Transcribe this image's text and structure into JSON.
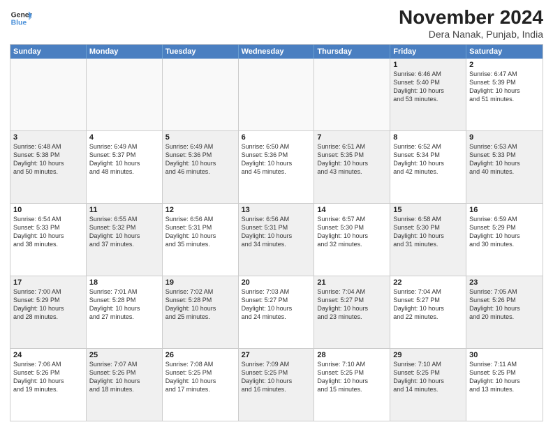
{
  "header": {
    "logo_line1": "General",
    "logo_line2": "Blue",
    "title": "November 2024",
    "subtitle": "Dera Nanak, Punjab, India"
  },
  "calendar": {
    "days": [
      "Sunday",
      "Monday",
      "Tuesday",
      "Wednesday",
      "Thursday",
      "Friday",
      "Saturday"
    ],
    "weeks": [
      [
        {
          "day": "",
          "text": "",
          "empty": true
        },
        {
          "day": "",
          "text": "",
          "empty": true
        },
        {
          "day": "",
          "text": "",
          "empty": true
        },
        {
          "day": "",
          "text": "",
          "empty": true
        },
        {
          "day": "",
          "text": "",
          "empty": true
        },
        {
          "day": "1",
          "text": "Sunrise: 6:46 AM\nSunset: 5:40 PM\nDaylight: 10 hours\nand 53 minutes.",
          "shaded": true
        },
        {
          "day": "2",
          "text": "Sunrise: 6:47 AM\nSunset: 5:39 PM\nDaylight: 10 hours\nand 51 minutes.",
          "shaded": false
        }
      ],
      [
        {
          "day": "3",
          "text": "Sunrise: 6:48 AM\nSunset: 5:38 PM\nDaylight: 10 hours\nand 50 minutes.",
          "shaded": true
        },
        {
          "day": "4",
          "text": "Sunrise: 6:49 AM\nSunset: 5:37 PM\nDaylight: 10 hours\nand 48 minutes.",
          "shaded": false
        },
        {
          "day": "5",
          "text": "Sunrise: 6:49 AM\nSunset: 5:36 PM\nDaylight: 10 hours\nand 46 minutes.",
          "shaded": true
        },
        {
          "day": "6",
          "text": "Sunrise: 6:50 AM\nSunset: 5:36 PM\nDaylight: 10 hours\nand 45 minutes.",
          "shaded": false
        },
        {
          "day": "7",
          "text": "Sunrise: 6:51 AM\nSunset: 5:35 PM\nDaylight: 10 hours\nand 43 minutes.",
          "shaded": true
        },
        {
          "day": "8",
          "text": "Sunrise: 6:52 AM\nSunset: 5:34 PM\nDaylight: 10 hours\nand 42 minutes.",
          "shaded": false
        },
        {
          "day": "9",
          "text": "Sunrise: 6:53 AM\nSunset: 5:33 PM\nDaylight: 10 hours\nand 40 minutes.",
          "shaded": true
        }
      ],
      [
        {
          "day": "10",
          "text": "Sunrise: 6:54 AM\nSunset: 5:33 PM\nDaylight: 10 hours\nand 38 minutes.",
          "shaded": false
        },
        {
          "day": "11",
          "text": "Sunrise: 6:55 AM\nSunset: 5:32 PM\nDaylight: 10 hours\nand 37 minutes.",
          "shaded": true
        },
        {
          "day": "12",
          "text": "Sunrise: 6:56 AM\nSunset: 5:31 PM\nDaylight: 10 hours\nand 35 minutes.",
          "shaded": false
        },
        {
          "day": "13",
          "text": "Sunrise: 6:56 AM\nSunset: 5:31 PM\nDaylight: 10 hours\nand 34 minutes.",
          "shaded": true
        },
        {
          "day": "14",
          "text": "Sunrise: 6:57 AM\nSunset: 5:30 PM\nDaylight: 10 hours\nand 32 minutes.",
          "shaded": false
        },
        {
          "day": "15",
          "text": "Sunrise: 6:58 AM\nSunset: 5:30 PM\nDaylight: 10 hours\nand 31 minutes.",
          "shaded": true
        },
        {
          "day": "16",
          "text": "Sunrise: 6:59 AM\nSunset: 5:29 PM\nDaylight: 10 hours\nand 30 minutes.",
          "shaded": false
        }
      ],
      [
        {
          "day": "17",
          "text": "Sunrise: 7:00 AM\nSunset: 5:29 PM\nDaylight: 10 hours\nand 28 minutes.",
          "shaded": true
        },
        {
          "day": "18",
          "text": "Sunrise: 7:01 AM\nSunset: 5:28 PM\nDaylight: 10 hours\nand 27 minutes.",
          "shaded": false
        },
        {
          "day": "19",
          "text": "Sunrise: 7:02 AM\nSunset: 5:28 PM\nDaylight: 10 hours\nand 25 minutes.",
          "shaded": true
        },
        {
          "day": "20",
          "text": "Sunrise: 7:03 AM\nSunset: 5:27 PM\nDaylight: 10 hours\nand 24 minutes.",
          "shaded": false
        },
        {
          "day": "21",
          "text": "Sunrise: 7:04 AM\nSunset: 5:27 PM\nDaylight: 10 hours\nand 23 minutes.",
          "shaded": true
        },
        {
          "day": "22",
          "text": "Sunrise: 7:04 AM\nSunset: 5:27 PM\nDaylight: 10 hours\nand 22 minutes.",
          "shaded": false
        },
        {
          "day": "23",
          "text": "Sunrise: 7:05 AM\nSunset: 5:26 PM\nDaylight: 10 hours\nand 20 minutes.",
          "shaded": true
        }
      ],
      [
        {
          "day": "24",
          "text": "Sunrise: 7:06 AM\nSunset: 5:26 PM\nDaylight: 10 hours\nand 19 minutes.",
          "shaded": false
        },
        {
          "day": "25",
          "text": "Sunrise: 7:07 AM\nSunset: 5:26 PM\nDaylight: 10 hours\nand 18 minutes.",
          "shaded": true
        },
        {
          "day": "26",
          "text": "Sunrise: 7:08 AM\nSunset: 5:25 PM\nDaylight: 10 hours\nand 17 minutes.",
          "shaded": false
        },
        {
          "day": "27",
          "text": "Sunrise: 7:09 AM\nSunset: 5:25 PM\nDaylight: 10 hours\nand 16 minutes.",
          "shaded": true
        },
        {
          "day": "28",
          "text": "Sunrise: 7:10 AM\nSunset: 5:25 PM\nDaylight: 10 hours\nand 15 minutes.",
          "shaded": false
        },
        {
          "day": "29",
          "text": "Sunrise: 7:10 AM\nSunset: 5:25 PM\nDaylight: 10 hours\nand 14 minutes.",
          "shaded": true
        },
        {
          "day": "30",
          "text": "Sunrise: 7:11 AM\nSunset: 5:25 PM\nDaylight: 10 hours\nand 13 minutes.",
          "shaded": false
        }
      ]
    ]
  }
}
